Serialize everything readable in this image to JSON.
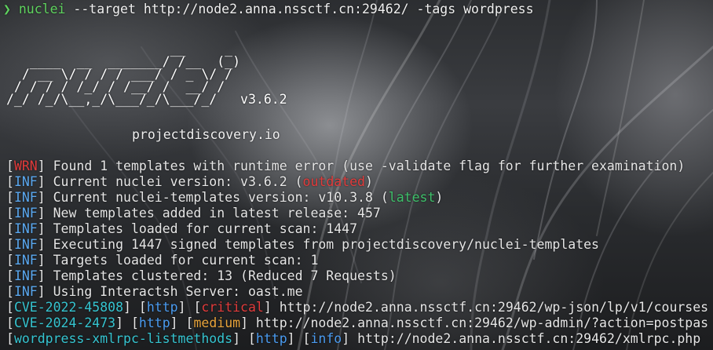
{
  "command": {
    "prompt": "❯",
    "binary": "nuclei",
    "args": " --target http://node2.anna.nssctf.cn:29462/ -tags wordpress"
  },
  "banner": {
    "art": [
      "                     __     _",
      "   ____  __  _______/ /__  (_)",
      "  / __ \\/ / / / ___/ / _ \\/ /",
      " / / / / /_/ / /__/ /  __/ /",
      "/_/ /_/\\__,_/\\___/_/\\___/_/   v3.6.2"
    ],
    "site": "projectdiscovery.io"
  },
  "logs": [
    {
      "tag": "WRN",
      "level": "wrn",
      "text": " Found 1 templates with runtime error (use -validate flag for further examination)"
    },
    {
      "tag": "INF",
      "level": "inf",
      "text": " Current nuclei version: v3.6.2 (",
      "status": "outdated",
      "status_color": "red",
      "suffix": ")"
    },
    {
      "tag": "INF",
      "level": "inf",
      "text": " Current nuclei-templates version: v10.3.8 (",
      "status": "latest",
      "status_color": "green",
      "suffix": ")"
    },
    {
      "tag": "INF",
      "level": "inf",
      "text": " New templates added in latest release: 457"
    },
    {
      "tag": "INF",
      "level": "inf",
      "text": " Templates loaded for current scan: 1447"
    },
    {
      "tag": "INF",
      "level": "inf",
      "text": " Executing 1447 signed templates from projectdiscovery/nuclei-templates"
    },
    {
      "tag": "INF",
      "level": "inf",
      "text": " Targets loaded for current scan: 1"
    },
    {
      "tag": "INF",
      "level": "inf",
      "text": " Templates clustered: 13 (Reduced 7 Requests)"
    },
    {
      "tag": "INF",
      "level": "inf",
      "text": " Using Interactsh Server: oast.me"
    }
  ],
  "results": [
    {
      "template": "CVE-2022-45808",
      "protocol": "http",
      "severity": "critical",
      "severity_color": "red",
      "url": " http://node2.anna.nssctf.cn:29462/wp-json/lp/v1/courses"
    },
    {
      "template": "CVE-2024-2473",
      "protocol": "http",
      "severity": "medium",
      "severity_color": "orange",
      "url": " http://node2.anna.nssctf.cn:29462/wp-admin/?action=postpas"
    },
    {
      "template": "wordpress-xmlrpc-listmethods",
      "protocol": "http",
      "severity": "info",
      "severity_color": "blue",
      "url": " http://node2.anna.nssctf.cn:29462/xmlrpc.php"
    }
  ],
  "colors": {
    "prompt": "#5fd35f",
    "warn": "#e23b3b",
    "info_tag": "#5aa8f0",
    "template_id": "#35c4d0",
    "critical": "#e23b3b",
    "medium": "#e8a33a",
    "latest": "#3ec06a"
  }
}
